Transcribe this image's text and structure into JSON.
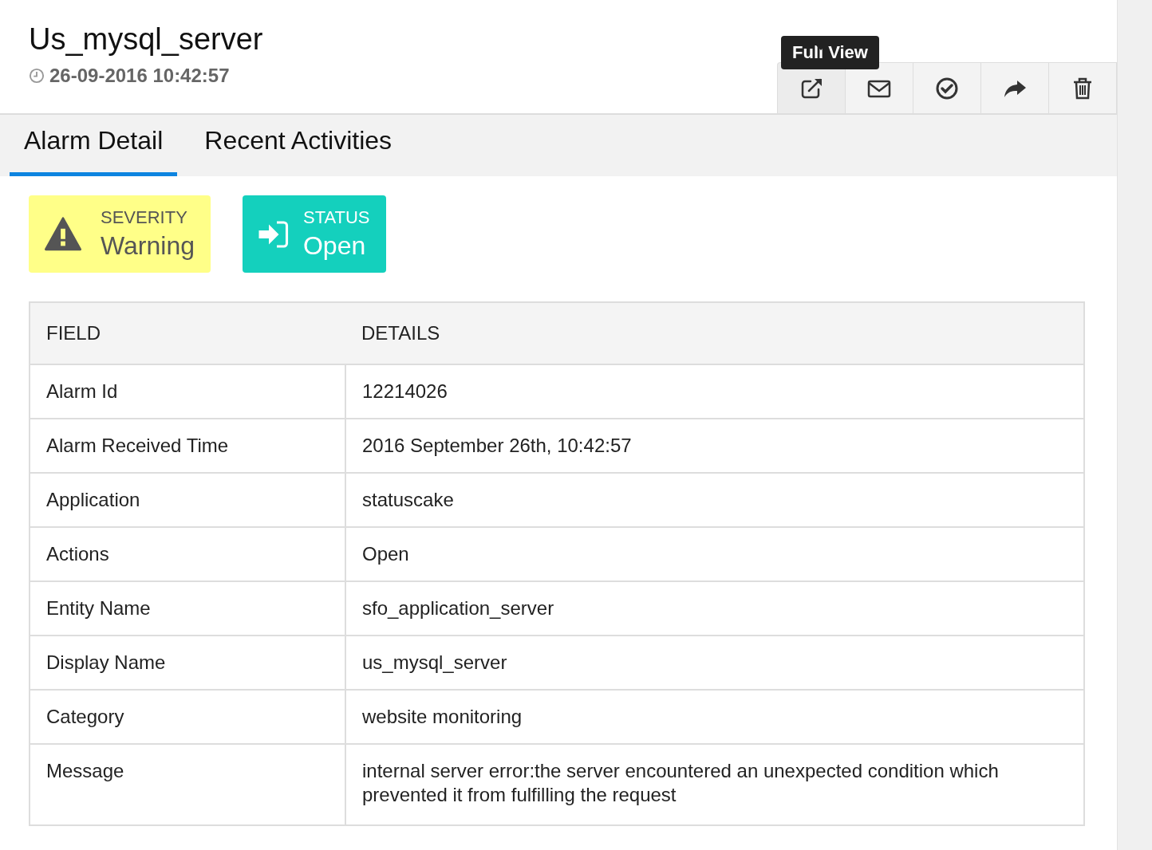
{
  "header": {
    "title": "Us_mysql_server",
    "timestamp": "26-09-2016 10:42:57"
  },
  "toolbar": {
    "tooltip": "Full View",
    "buttons": [
      {
        "kind": "full-view"
      },
      {
        "kind": "email"
      },
      {
        "kind": "resolve"
      },
      {
        "kind": "forward"
      },
      {
        "kind": "delete"
      }
    ]
  },
  "tabs": [
    {
      "label": "Alarm Detail",
      "selected": true
    },
    {
      "label": "Recent Activities",
      "selected": false
    }
  ],
  "cards": [
    {
      "kind": "severity",
      "label": "SEVERITY",
      "value": "Warning",
      "color": "#ffff88"
    },
    {
      "kind": "status",
      "label": "STATUS",
      "value": "Open",
      "color": "#14d0bd"
    }
  ],
  "table": {
    "columns": [
      "FIELD",
      "DETAILS"
    ],
    "rows": [
      [
        "Alarm Id",
        "12214026"
      ],
      [
        "Alarm Received Time",
        "2016 September 26th, 10:42:57"
      ],
      [
        "Application",
        "statuscake"
      ],
      [
        "Actions",
        "Open"
      ],
      [
        "Entity Name",
        "sfo_application_server"
      ],
      [
        "Display Name",
        "us_mysql_server"
      ],
      [
        "Category",
        "website monitoring"
      ],
      [
        "Message",
        "internal server error:the server encountered an unexpected condition which prevented it from fulfilling the request"
      ]
    ]
  }
}
